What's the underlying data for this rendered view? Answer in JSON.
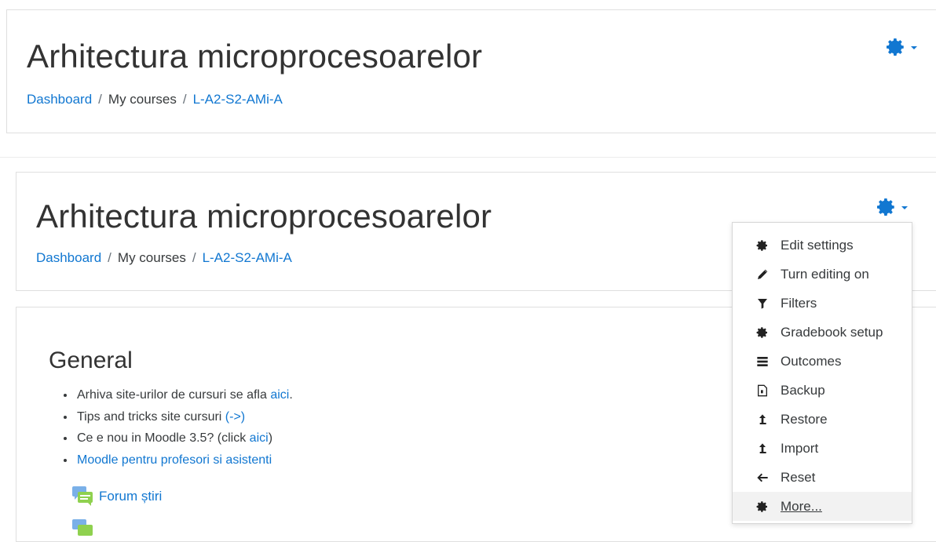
{
  "header_top": {
    "title": "Arhitectura microprocesoarelor",
    "breadcrumb": [
      "Dashboard",
      "My courses",
      "L-A2-S2-AMi-A"
    ]
  },
  "header_main": {
    "title": "Arhitectura microprocesoarelor",
    "breadcrumb": [
      "Dashboard",
      "My courses",
      "L-A2-S2-AMi-A"
    ]
  },
  "admin_menu": {
    "items": [
      {
        "label": "Edit settings",
        "icon": "gear-icon"
      },
      {
        "label": "Turn editing on",
        "icon": "pencil-icon"
      },
      {
        "label": "Filters",
        "icon": "filter-icon"
      },
      {
        "label": "Gradebook setup",
        "icon": "gear-icon"
      },
      {
        "label": "Outcomes",
        "icon": "outcomes-icon"
      },
      {
        "label": "Backup",
        "icon": "backup-file-icon"
      },
      {
        "label": "Restore",
        "icon": "restore-arrow-icon"
      },
      {
        "label": "Import",
        "icon": "import-arrow-icon"
      },
      {
        "label": "Reset",
        "icon": "arrow-left-icon"
      },
      {
        "label": "More...",
        "icon": "gear-icon"
      }
    ]
  },
  "section": {
    "title": "General",
    "bullets": [
      {
        "text": "Arhiva site-urilor de cursuri se afla ",
        "link": "aici",
        "suffix": "."
      },
      {
        "text": "Tips and tricks site cursuri ",
        "link": "(->)",
        "suffix": ""
      },
      {
        "text": "Ce e nou in Moodle 3.5? (click ",
        "link": "aici",
        "suffix": ")"
      },
      {
        "text": "",
        "link": "Moodle pentru profesori si asistenti",
        "suffix": ""
      }
    ],
    "activities": [
      "Forum știri"
    ]
  },
  "colors": {
    "link": "#1177d1",
    "text": "#373a3c",
    "border": "#dfdfdf"
  }
}
